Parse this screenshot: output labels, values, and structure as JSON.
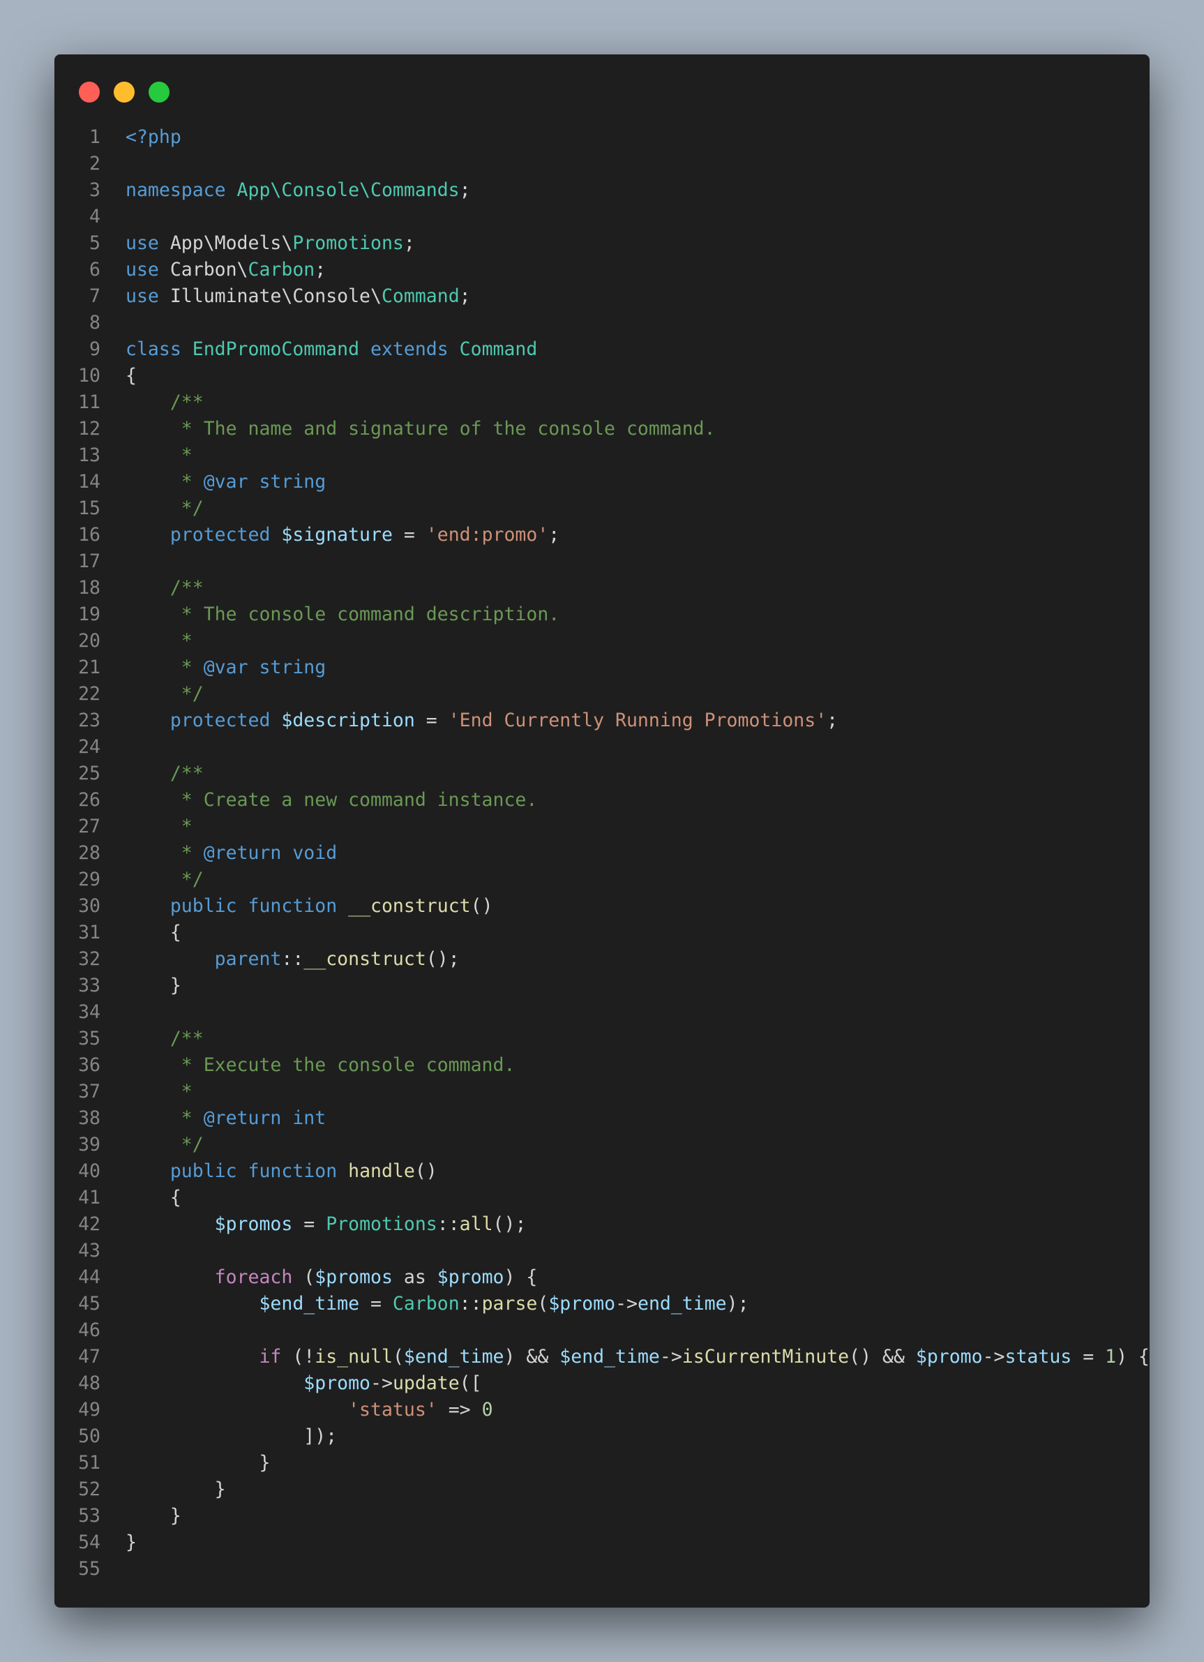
{
  "window": {
    "controls": [
      {
        "name": "close",
        "color": "#ff5f56"
      },
      {
        "name": "minimize",
        "color": "#ffbd2e"
      },
      {
        "name": "maximize",
        "color": "#27c93f"
      }
    ]
  },
  "code": {
    "lines": [
      [
        [
          "kw",
          "<?php"
        ]
      ],
      [],
      [
        [
          "kw",
          "namespace "
        ],
        [
          "ty",
          "App\\Console\\Commands"
        ],
        [
          "pl",
          ";"
        ]
      ],
      [],
      [
        [
          "kw",
          "use "
        ],
        [
          "pl",
          "App\\Models\\"
        ],
        [
          "ty",
          "Promotions"
        ],
        [
          "pl",
          ";"
        ]
      ],
      [
        [
          "kw",
          "use "
        ],
        [
          "pl",
          "Carbon\\"
        ],
        [
          "ty",
          "Carbon"
        ],
        [
          "pl",
          ";"
        ]
      ],
      [
        [
          "kw",
          "use "
        ],
        [
          "pl",
          "Illuminate\\Console\\"
        ],
        [
          "ty",
          "Command"
        ],
        [
          "pl",
          ";"
        ]
      ],
      [],
      [
        [
          "kw",
          "class "
        ],
        [
          "ty",
          "EndPromoCommand"
        ],
        [
          "kw",
          " extends "
        ],
        [
          "ty",
          "Command"
        ]
      ],
      [
        [
          "pl",
          "{"
        ]
      ],
      [
        [
          "pl",
          "    "
        ],
        [
          "cm",
          "/**"
        ]
      ],
      [
        [
          "pl",
          "     "
        ],
        [
          "cm",
          "* The name and signature of the console command."
        ]
      ],
      [
        [
          "pl",
          "     "
        ],
        [
          "cm",
          "*"
        ]
      ],
      [
        [
          "pl",
          "     "
        ],
        [
          "cm",
          "* "
        ],
        [
          "kw",
          "@var string"
        ]
      ],
      [
        [
          "pl",
          "     "
        ],
        [
          "cm",
          "*/"
        ]
      ],
      [
        [
          "pl",
          "    "
        ],
        [
          "kw",
          "protected "
        ],
        [
          "va",
          "$signature"
        ],
        [
          "pl",
          " = "
        ],
        [
          "st",
          "'end:promo'"
        ],
        [
          "pl",
          ";"
        ]
      ],
      [],
      [
        [
          "pl",
          "    "
        ],
        [
          "cm",
          "/**"
        ]
      ],
      [
        [
          "pl",
          "     "
        ],
        [
          "cm",
          "* The console command description."
        ]
      ],
      [
        [
          "pl",
          "     "
        ],
        [
          "cm",
          "*"
        ]
      ],
      [
        [
          "pl",
          "     "
        ],
        [
          "cm",
          "* "
        ],
        [
          "kw",
          "@var string"
        ]
      ],
      [
        [
          "pl",
          "     "
        ],
        [
          "cm",
          "*/"
        ]
      ],
      [
        [
          "pl",
          "    "
        ],
        [
          "kw",
          "protected "
        ],
        [
          "va",
          "$description"
        ],
        [
          "pl",
          " = "
        ],
        [
          "st",
          "'End Currently Running Promotions'"
        ],
        [
          "pl",
          ";"
        ]
      ],
      [],
      [
        [
          "pl",
          "    "
        ],
        [
          "cm",
          "/**"
        ]
      ],
      [
        [
          "pl",
          "     "
        ],
        [
          "cm",
          "* Create a new command instance."
        ]
      ],
      [
        [
          "pl",
          "     "
        ],
        [
          "cm",
          "*"
        ]
      ],
      [
        [
          "pl",
          "     "
        ],
        [
          "cm",
          "* "
        ],
        [
          "kw",
          "@return void"
        ]
      ],
      [
        [
          "pl",
          "     "
        ],
        [
          "cm",
          "*/"
        ]
      ],
      [
        [
          "pl",
          "    "
        ],
        [
          "kw",
          "public function "
        ],
        [
          "fn",
          "__construct"
        ],
        [
          "pl",
          "()"
        ]
      ],
      [
        [
          "pl",
          "    {"
        ]
      ],
      [
        [
          "pl",
          "        "
        ],
        [
          "kw",
          "parent"
        ],
        [
          "pl",
          "::"
        ],
        [
          "fn",
          "__construct"
        ],
        [
          "pl",
          "();"
        ]
      ],
      [
        [
          "pl",
          "    }"
        ]
      ],
      [],
      [
        [
          "pl",
          "    "
        ],
        [
          "cm",
          "/**"
        ]
      ],
      [
        [
          "pl",
          "     "
        ],
        [
          "cm",
          "* Execute the console command."
        ]
      ],
      [
        [
          "pl",
          "     "
        ],
        [
          "cm",
          "*"
        ]
      ],
      [
        [
          "pl",
          "     "
        ],
        [
          "cm",
          "* "
        ],
        [
          "kw",
          "@return int"
        ]
      ],
      [
        [
          "pl",
          "     "
        ],
        [
          "cm",
          "*/"
        ]
      ],
      [
        [
          "pl",
          "    "
        ],
        [
          "kw",
          "public function "
        ],
        [
          "fn",
          "handle"
        ],
        [
          "pl",
          "()"
        ]
      ],
      [
        [
          "pl",
          "    {"
        ]
      ],
      [
        [
          "pl",
          "        "
        ],
        [
          "va",
          "$promos"
        ],
        [
          "pl",
          " = "
        ],
        [
          "ty",
          "Promotions"
        ],
        [
          "pl",
          "::"
        ],
        [
          "fn",
          "all"
        ],
        [
          "pl",
          "();"
        ]
      ],
      [],
      [
        [
          "pl",
          "        "
        ],
        [
          "ctl",
          "foreach"
        ],
        [
          "pl",
          " ("
        ],
        [
          "va",
          "$promos"
        ],
        [
          "pl",
          " as "
        ],
        [
          "va",
          "$promo"
        ],
        [
          "pl",
          ") {"
        ]
      ],
      [
        [
          "pl",
          "            "
        ],
        [
          "va",
          "$end_time"
        ],
        [
          "pl",
          " = "
        ],
        [
          "ty",
          "Carbon"
        ],
        [
          "pl",
          "::"
        ],
        [
          "fn",
          "parse"
        ],
        [
          "pl",
          "("
        ],
        [
          "va",
          "$promo"
        ],
        [
          "pl",
          "->"
        ],
        [
          "va",
          "end_time"
        ],
        [
          "pl",
          ");"
        ]
      ],
      [],
      [
        [
          "pl",
          "            "
        ],
        [
          "ctl",
          "if"
        ],
        [
          "pl",
          " (!"
        ],
        [
          "fn",
          "is_null"
        ],
        [
          "pl",
          "("
        ],
        [
          "va",
          "$end_time"
        ],
        [
          "pl",
          ") && "
        ],
        [
          "va",
          "$end_time"
        ],
        [
          "pl",
          "->"
        ],
        [
          "fn",
          "isCurrentMinute"
        ],
        [
          "pl",
          "() && "
        ],
        [
          "va",
          "$promo"
        ],
        [
          "pl",
          "->"
        ],
        [
          "va",
          "status"
        ],
        [
          "pl",
          " = "
        ],
        [
          "nm",
          "1"
        ],
        [
          "pl",
          ") {"
        ]
      ],
      [
        [
          "pl",
          "                "
        ],
        [
          "va",
          "$promo"
        ],
        [
          "pl",
          "->"
        ],
        [
          "fn",
          "update"
        ],
        [
          "pl",
          "(["
        ]
      ],
      [
        [
          "pl",
          "                    "
        ],
        [
          "st",
          "'status'"
        ],
        [
          "pl",
          " => "
        ],
        [
          "nm",
          "0"
        ]
      ],
      [
        [
          "pl",
          "                ]);"
        ]
      ],
      [
        [
          "pl",
          "            }"
        ]
      ],
      [
        [
          "pl",
          "        }"
        ]
      ],
      [
        [
          "pl",
          "    }"
        ]
      ],
      [
        [
          "pl",
          "}"
        ]
      ],
      []
    ]
  }
}
